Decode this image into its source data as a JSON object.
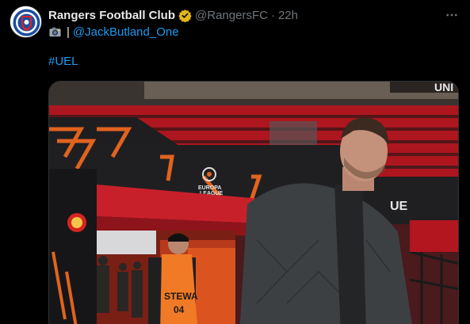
{
  "tweet": {
    "author": {
      "display_name": "Rangers Football Club",
      "handle": "@RangersFC",
      "verified": true,
      "verified_color": "#e2b719"
    },
    "timestamp": "22h",
    "separator": "·",
    "text_line": {
      "camera_icon": "camera-icon",
      "divider": "|",
      "mention": "@JackButland_One"
    },
    "hashtag": "#UEL",
    "more_icon": "more-icon",
    "media": {
      "sign_text": "STEWA",
      "sign_number": "04",
      "league_text_1": "EUROPA",
      "league_text_2": "LEAGUE",
      "board_text": "UE",
      "stand_text": "UNI"
    }
  },
  "colors": {
    "background": "#000000",
    "text": "#e7e9ea",
    "muted": "#71767b",
    "link": "#1d9bf0"
  }
}
